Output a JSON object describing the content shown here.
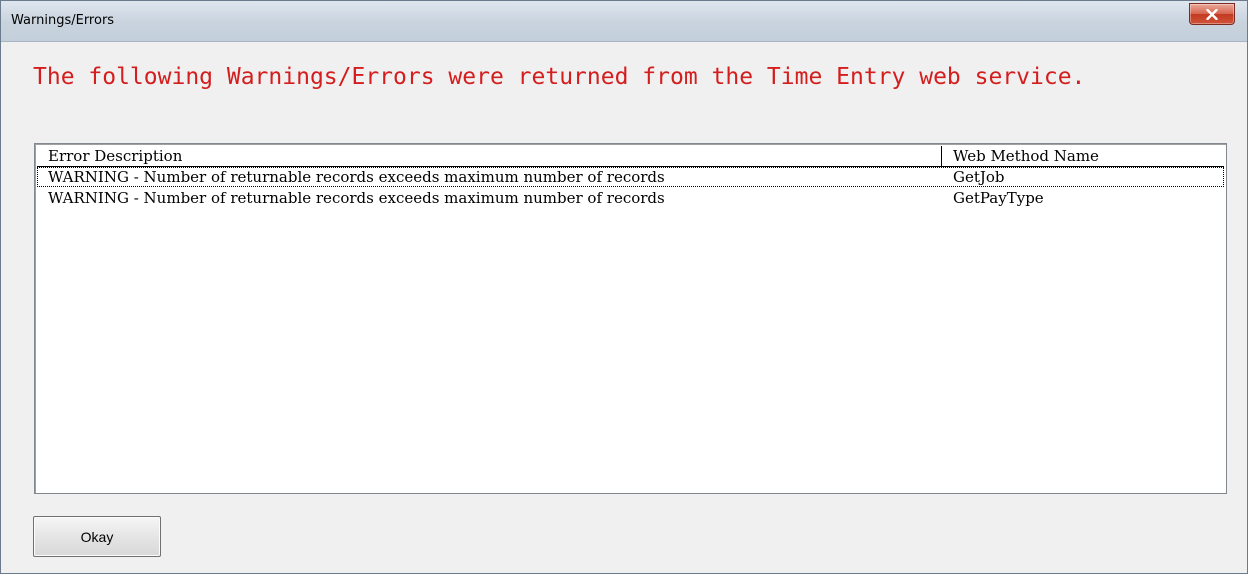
{
  "window": {
    "title": "Warnings/Errors",
    "close_icon": "close-x-icon"
  },
  "message": "The following Warnings/Errors were returned from the Time Entry web service.",
  "list": {
    "columns": [
      "Error Description",
      "Web Method Name"
    ],
    "rows": [
      {
        "description": "WARNING - Number of returnable records exceeds maximum number of records",
        "method": "GetJob",
        "selected": true
      },
      {
        "description": "WARNING - Number of returnable records exceeds maximum number of records",
        "method": "GetPayType",
        "selected": false
      }
    ]
  },
  "buttons": {
    "okay_label": "Okay"
  },
  "colors": {
    "message_text": "#d41e1e",
    "close_button": "#c23b22"
  }
}
